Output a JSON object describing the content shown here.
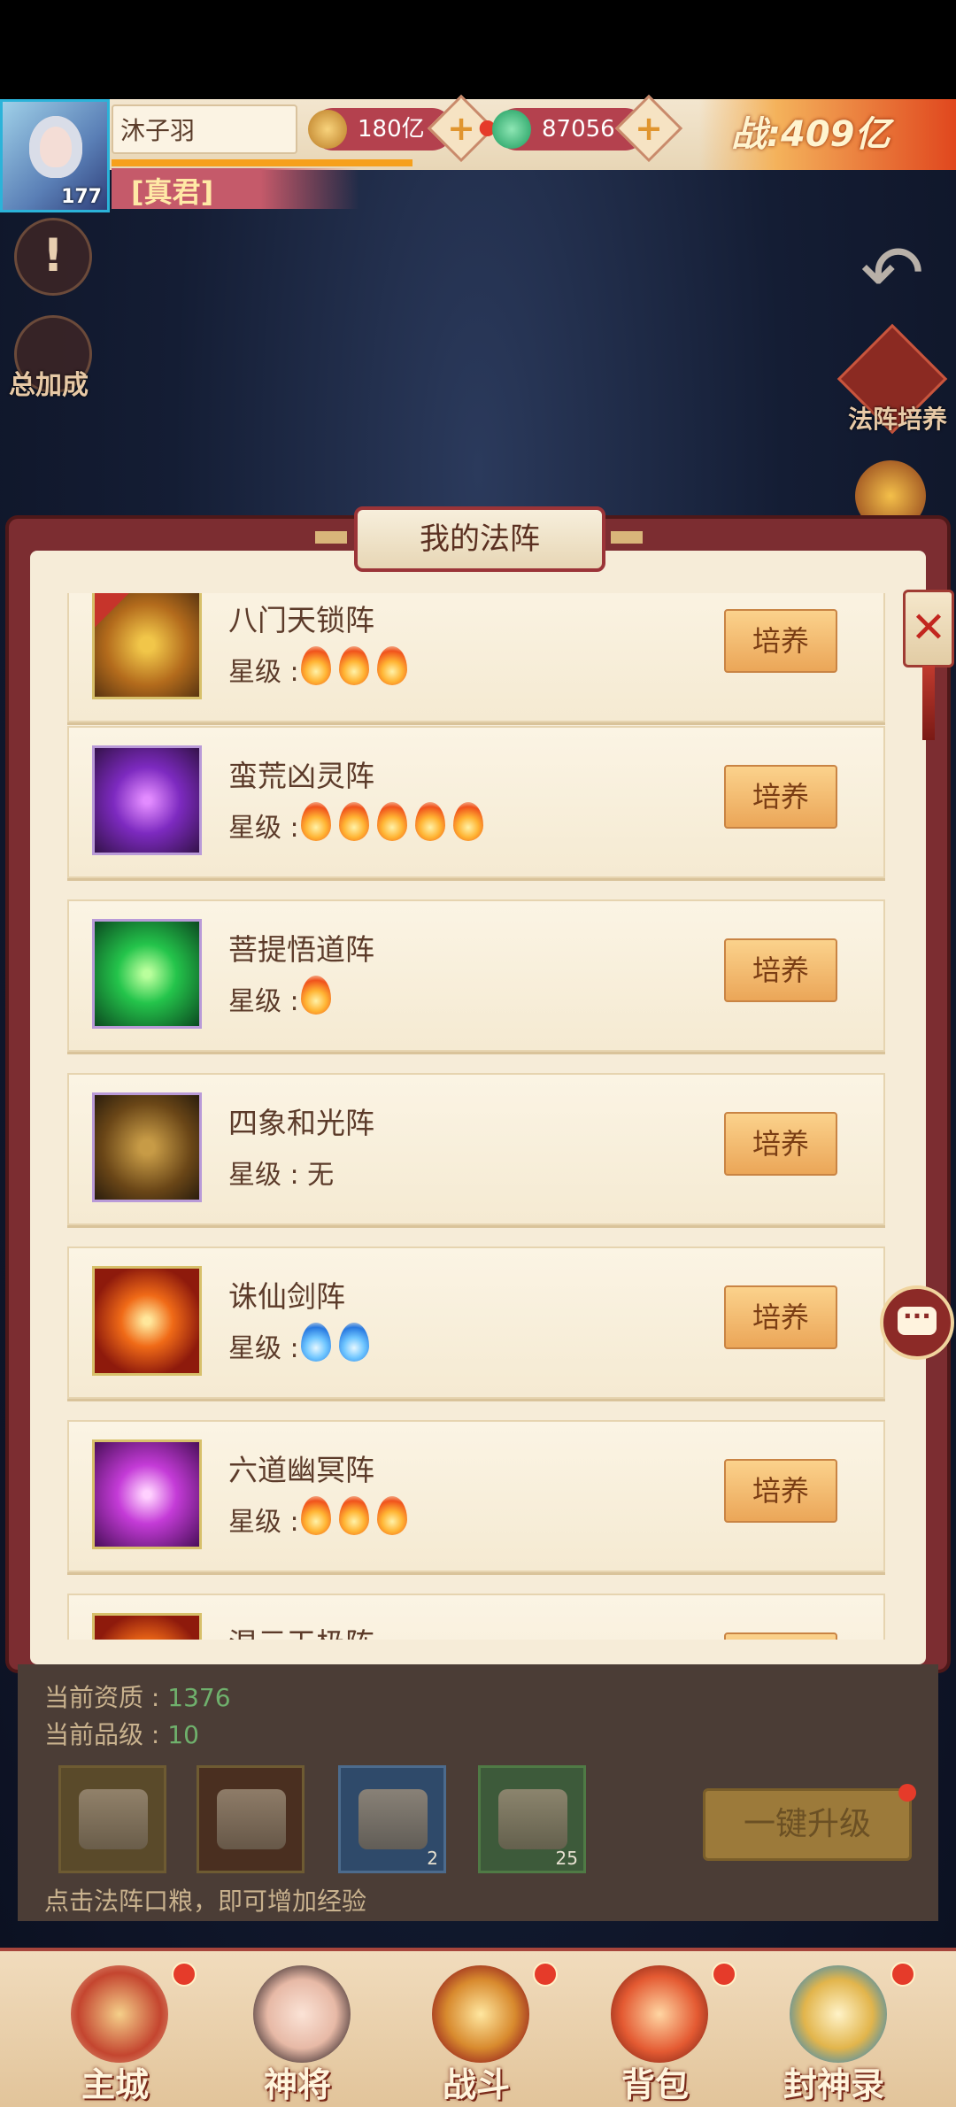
{
  "player": {
    "name": "沐子羽",
    "level": "177",
    "title": "[真君]",
    "currency_gold": "180亿",
    "currency_jade": "87056",
    "power": "战:409亿"
  },
  "side": {
    "bonus_label": "总加成",
    "formation_train_label": "法阵培养"
  },
  "panel": {
    "title": "我的法阵",
    "train_button": "培养",
    "star_prefix": "星级 :",
    "none_text": "星级 : 无"
  },
  "formations": [
    {
      "name": "八门天锁阵",
      "stars": 3,
      "star_type": "fire",
      "icon": "gold-formation-icon"
    },
    {
      "name": "蛮荒凶灵阵",
      "stars": 5,
      "star_type": "fire",
      "icon": "purple-beast-formation-icon"
    },
    {
      "name": "菩提悟道阵",
      "stars": 1,
      "star_type": "fire",
      "icon": "green-bodhi-formation-icon"
    },
    {
      "name": "四象和光阵",
      "stars": 0,
      "star_type": "none",
      "icon": "four-elements-formation-icon"
    },
    {
      "name": "诛仙剑阵",
      "stars": 2,
      "star_type": "blue",
      "icon": "red-sword-formation-icon"
    },
    {
      "name": "六道幽冥阵",
      "stars": 3,
      "star_type": "fire",
      "icon": "violet-netherworld-formation-icon"
    },
    {
      "name": "混元天极阵",
      "stars": 0,
      "star_type": "none",
      "icon": "red-formation-icon"
    }
  ],
  "info": {
    "quality_label": "当前资质 :",
    "quality_value": "1376",
    "grade_label": "当前品级 :",
    "grade_value": "10",
    "slot3_count": "2",
    "slot4_count": "25",
    "upgrade_button": "一键升级",
    "hint": "点击法阵口粮，即可增加经验"
  },
  "nav": [
    {
      "label": "主城",
      "icon": "main-city-icon"
    },
    {
      "label": "神将",
      "icon": "hero-icon"
    },
    {
      "label": "战斗",
      "icon": "battle-swords-icon"
    },
    {
      "label": "背包",
      "icon": "backpack-icon"
    },
    {
      "label": "封神录",
      "icon": "deification-record-icon"
    }
  ]
}
